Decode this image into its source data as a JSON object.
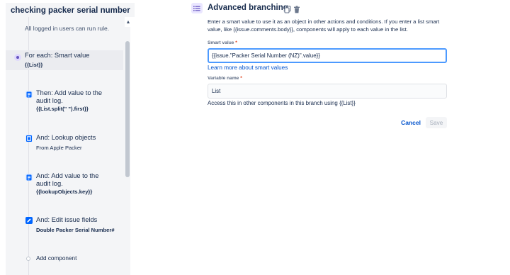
{
  "rule": {
    "title": "checking packer serial number",
    "note": "All logged in users can run rule."
  },
  "steps": [
    {
      "title": "For each: Smart value",
      "subtitle": "{{List}}",
      "icon": "branch-icon",
      "selected": true
    },
    {
      "title": "Then: Add value to the audit log.",
      "subtitle": "{{List.split(\" \").first}}",
      "icon": "audit-log-icon"
    },
    {
      "title": "And: Lookup objects",
      "subtitle": "From Apple Packer",
      "icon": "lookup-objects-icon"
    },
    {
      "title": "And: Add value to the audit log.",
      "subtitle": "{{lookupObjects.key}}",
      "icon": "audit-log-icon"
    },
    {
      "title": "And: Edit issue fields",
      "subtitle": "Double Packer Serial Number#",
      "icon": "edit-icon"
    }
  ],
  "add_component": "Add component",
  "panel": {
    "title": "Advanced branching",
    "description": "Enter a smart value to use it as an object in other actions and conditions. If you enter a list smart value, like {{issue.comments.body}}, components will apply to each value in the list.",
    "smart_value_label": "Smart value",
    "required_mark": "*",
    "smart_value": "{{issue.\"Packer Serial Number (NZ)\".value}}",
    "learn_more": "Learn more about smart values",
    "variable_name_label": "Variable name",
    "required_mark_2": "*",
    "variable_name": "List",
    "help_text": "Access this in other components in this branch using {{List}}",
    "cancel_label": "Cancel",
    "save_label": "Save"
  },
  "colors": {
    "link": "#0052cc",
    "branch_accent": "#6554c0",
    "focus_border": "#4c9aff",
    "action_icon": "#0065ff"
  }
}
